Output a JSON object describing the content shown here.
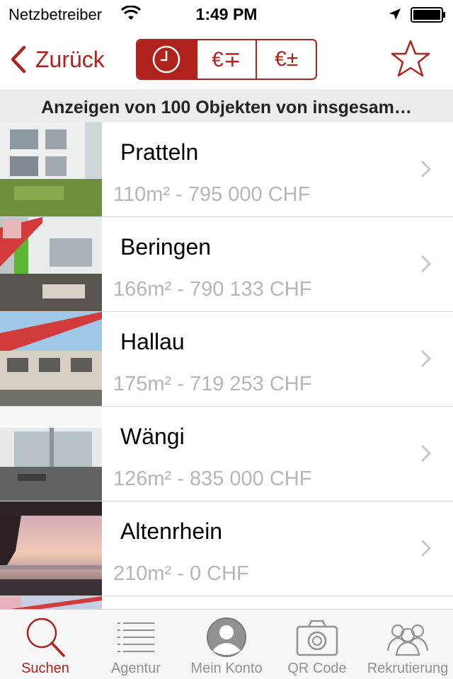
{
  "status_bar": {
    "carrier": "Netzbetreiber",
    "time": "1:49 PM",
    "wifi_icon": "wifi-icon",
    "location_icon": "location-arrow-icon",
    "battery_icon": "battery-icon"
  },
  "nav": {
    "back_label": "Zurück",
    "segments": [
      {
        "icon": "clock-icon",
        "label": "",
        "selected": true
      },
      {
        "icon": "euro-sort-icon",
        "label": "€∓",
        "selected": false
      },
      {
        "icon": "euro-sort-icon",
        "label": "€±",
        "selected": false
      }
    ],
    "favorite_icon": "star-icon",
    "accent_color": "#b0231c"
  },
  "summary": "Anzeigen von 100 Objekten von insgesam…",
  "listings": [
    {
      "title": "Pratteln",
      "subtitle": "110m² - 795 000 CHF"
    },
    {
      "title": "Beringen",
      "subtitle": "166m² - 790 133 CHF"
    },
    {
      "title": "Hallau",
      "subtitle": "175m² - 719 253 CHF"
    },
    {
      "title": "Wängi",
      "subtitle": "126m² - 835 000 CHF"
    },
    {
      "title": "Altenrhein",
      "subtitle": "210m² - 0 CHF"
    }
  ],
  "tabs": [
    {
      "icon": "search-icon",
      "label": "Suchen",
      "selected": true
    },
    {
      "icon": "list-icon",
      "label": "Agentur",
      "selected": false
    },
    {
      "icon": "person-icon",
      "label": "Mein Konto",
      "selected": false
    },
    {
      "icon": "camera-icon",
      "label": "QR Code",
      "selected": false
    },
    {
      "icon": "group-icon",
      "label": "Rekrutierung",
      "selected": false
    }
  ]
}
